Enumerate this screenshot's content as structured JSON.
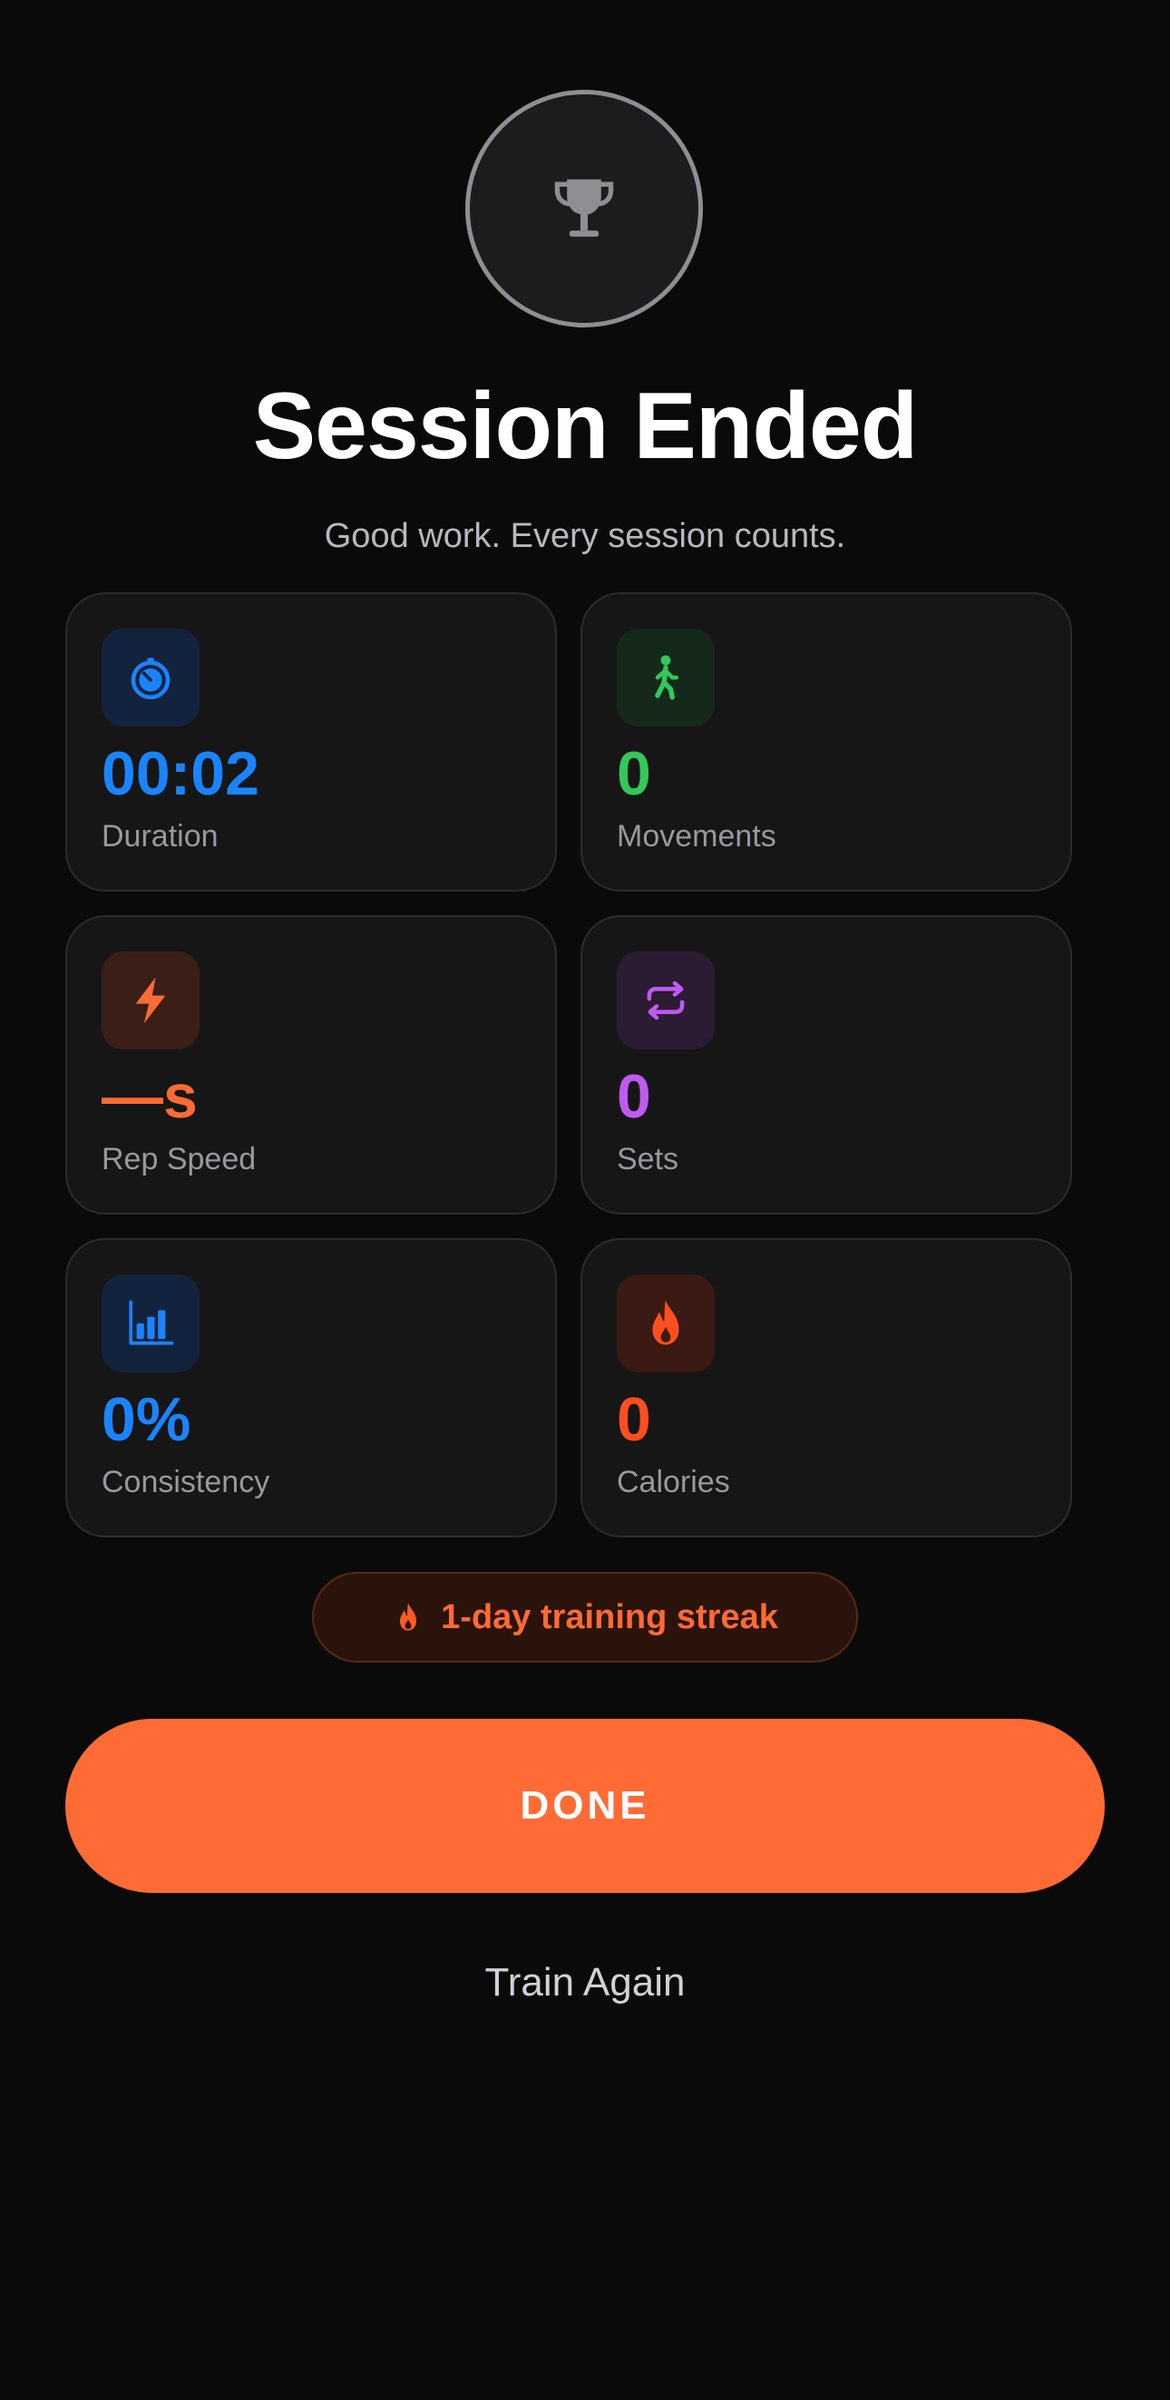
{
  "header": {
    "icon": "trophy-icon",
    "title": "Session Ended",
    "subtitle": "Good work. Every session counts."
  },
  "stats": [
    {
      "icon": "stopwatch-icon",
      "value": "00:02",
      "label": "Duration",
      "color": "#1a84ff",
      "bg": "#14233d"
    },
    {
      "icon": "walking-figure-icon",
      "value": "0",
      "label": "Movements",
      "color": "#34c759",
      "bg": "#15291b"
    },
    {
      "icon": "lightning-bolt-icon",
      "value": "—s",
      "label": "Rep Speed",
      "color": "#ff6b35",
      "bg": "#3a1f17"
    },
    {
      "icon": "repeat-icon",
      "value": "0",
      "label": "Sets",
      "color": "#bf5af2",
      "bg": "#2b1c34"
    },
    {
      "icon": "bar-chart-icon",
      "value": "0%",
      "label": "Consistency",
      "color": "#1a84ff",
      "bg": "#14233d"
    },
    {
      "icon": "flame-icon",
      "value": "0",
      "label": "Calories",
      "color": "#ff4f1f",
      "bg": "#3a1a12"
    }
  ],
  "streak": {
    "icon": "flame-icon",
    "text": "1-day training streak",
    "color": "#ff6a33"
  },
  "actions": {
    "done_label": "DONE",
    "train_again_label": "Train Again",
    "accent": "#ff6b35"
  }
}
